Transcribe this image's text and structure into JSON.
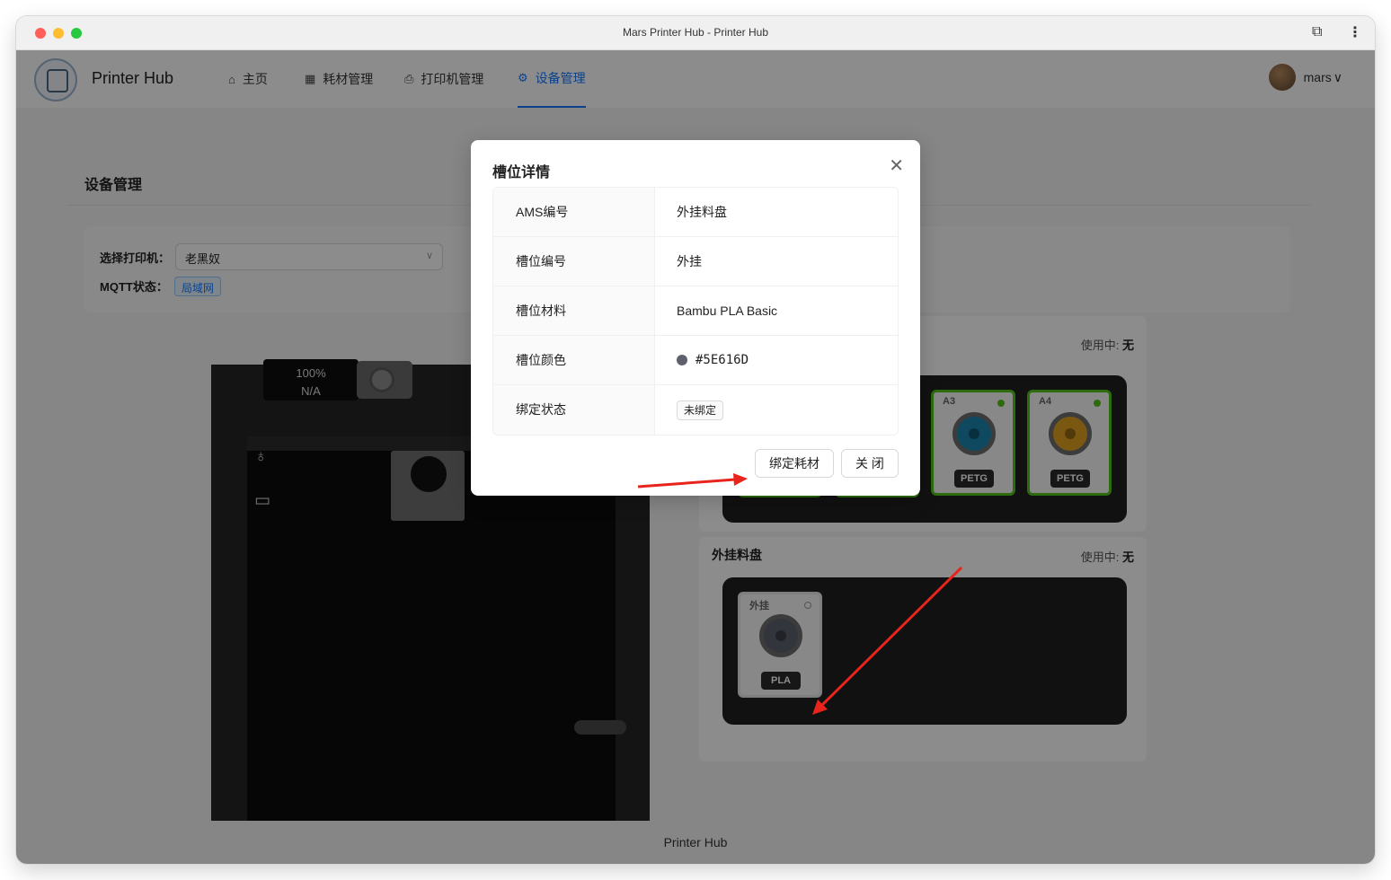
{
  "window": {
    "title": "Mars Printer Hub - Printer Hub"
  },
  "header": {
    "brand": "Printer Hub",
    "nav": [
      {
        "label": "主页",
        "icon": "home-icon"
      },
      {
        "label": "耗材管理",
        "icon": "grid-icon"
      },
      {
        "label": "打印机管理",
        "icon": "printer-icon"
      },
      {
        "label": "设备管理",
        "icon": "gear-icon",
        "active": true
      }
    ],
    "user": {
      "name": "mars"
    }
  },
  "page": {
    "title": "设备管理",
    "printer_select_label": "选择打印机：",
    "printer_selected": "老黑奴",
    "mqtt_label": "MQTT状态：",
    "mqtt_status": "局域网"
  },
  "printer_view": {
    "screen_line1": "100%",
    "screen_line2": "N/A"
  },
  "ams": {
    "status_label": "使用中:",
    "status_value": "无",
    "slots": [
      {
        "name": "A3",
        "material": "PETG",
        "color": "#1b86ad"
      },
      {
        "name": "A4",
        "material": "PETG",
        "color": "#e0a020"
      }
    ]
  },
  "external": {
    "title": "外挂料盘",
    "status_label": "使用中:",
    "status_value": "无",
    "slot": {
      "name": "外挂",
      "material": "PLA",
      "color": "#5E616D"
    }
  },
  "footer": {
    "text": "Printer Hub"
  },
  "modal": {
    "title": "槽位详情",
    "rows": [
      {
        "label": "AMS编号",
        "value": "外挂料盘"
      },
      {
        "label": "槽位编号",
        "value": "外挂"
      },
      {
        "label": "槽位材料",
        "value": "Bambu PLA Basic"
      },
      {
        "label": "槽位颜色",
        "value": "#5E616D",
        "swatch": "#5E616D"
      },
      {
        "label": "绑定状态",
        "value": "未绑定"
      }
    ],
    "bind_button": "绑定耗材",
    "close_button": "关 闭"
  },
  "colors": {
    "accent": "#1677ff",
    "annotation": "#e8241c",
    "slot_border": "#52c41a"
  }
}
